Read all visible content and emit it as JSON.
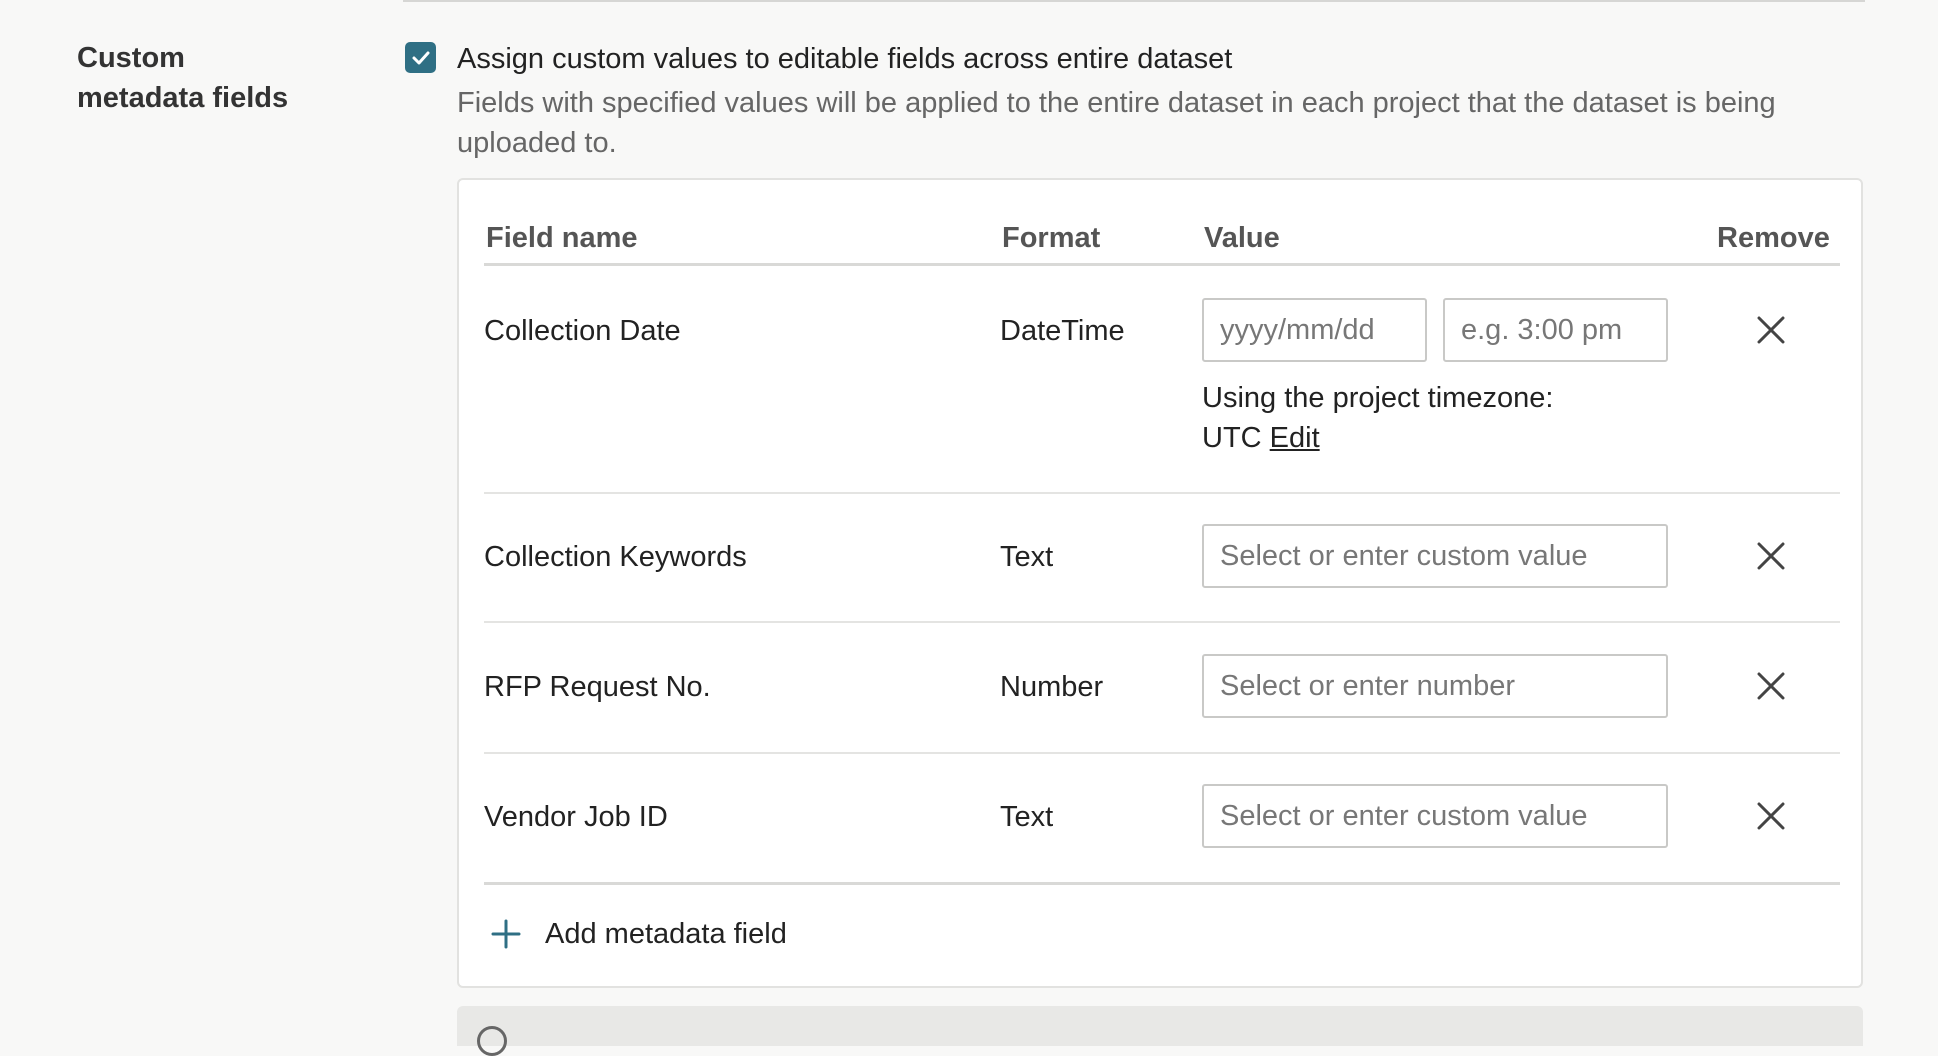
{
  "section": {
    "label": "Custom metadata fields"
  },
  "assign": {
    "checked": true,
    "label": "Assign custom values to editable fields across entire dataset",
    "description": "Fields with specified values will be applied to the entire dataset in each project that the dataset is being uploaded to."
  },
  "table": {
    "headers": {
      "field_name": "Field name",
      "format": "Format",
      "value": "Value",
      "remove": "Remove"
    },
    "rows": [
      {
        "field_name": "Collection Date",
        "format": "DateTime",
        "date_placeholder": "yyyy/mm/dd",
        "time_placeholder": "e.g. 3:00 pm",
        "tz_note": "Using the project timezone:",
        "tz_value": "UTC",
        "tz_edit": "Edit"
      },
      {
        "field_name": "Collection Keywords",
        "format": "Text",
        "placeholder": "Select or enter custom value"
      },
      {
        "field_name": "RFP Request No.",
        "format": "Number",
        "placeholder": "Select or enter number"
      },
      {
        "field_name": "Vendor Job ID",
        "format": "Text",
        "placeholder": "Select or enter custom value"
      }
    ],
    "add_label": "Add metadata field"
  },
  "colors": {
    "accent": "#2f6f84",
    "muted_text": "#666666"
  },
  "icons": {
    "check": "check-icon",
    "remove": "close-icon",
    "add": "plus-icon",
    "info": "info-icon"
  }
}
